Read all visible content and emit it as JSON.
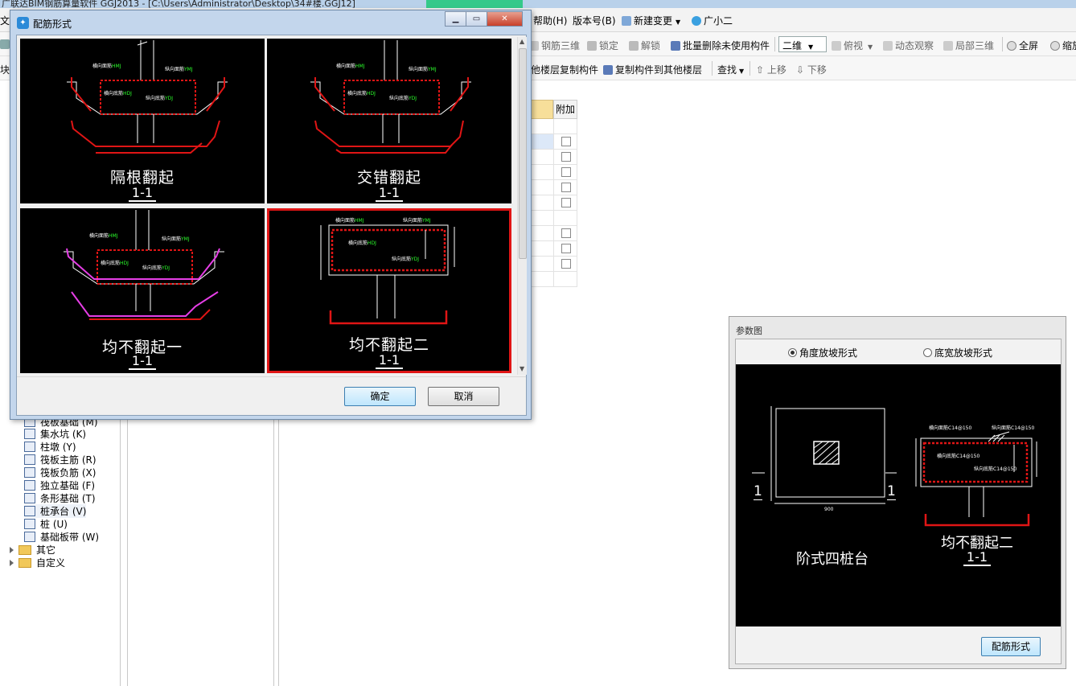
{
  "app": {
    "title": "广联达BIM钢筋算量软件 GGJ2013 - [C:\\Users\\Administrator\\Desktop\\34#楼.GGJ12]"
  },
  "menubar": {
    "help": "帮助(H)",
    "version": "版本号(B)",
    "new_change": "新建变更",
    "assistant": "广小二"
  },
  "toolbar1": {
    "rebar_3d": "钢筋三维",
    "lock": "锁定",
    "unlock": "解锁",
    "batch_delete": "批量删除未使用构件",
    "view_mode": "二维",
    "top_view": "俯视",
    "dynamic_view": "动态观察",
    "local_3d": "局部三维",
    "fullscreen": "全屏",
    "zoom": "缩放"
  },
  "toolbar2": {
    "copy_from_floor": "他楼层复制构件",
    "copy_to_floor": "复制构件到其他楼层",
    "find": "查找",
    "move_up": "上移",
    "move_down": "下移"
  },
  "left_tree": {
    "items": [
      {
        "label": "筏板基础 (M)"
      },
      {
        "label": "集水坑 (K)"
      },
      {
        "label": "柱墩 (Y)"
      },
      {
        "label": "筏板主筋 (R)"
      },
      {
        "label": "筏板负筋 (X)"
      },
      {
        "label": "独立基础 (F)"
      },
      {
        "label": "条形基础 (T)"
      },
      {
        "label": "桩承台 (V)"
      },
      {
        "label": "桩 (U)"
      },
      {
        "label": "基础板带 (W)"
      }
    ],
    "folders": [
      {
        "label": "其它"
      },
      {
        "label": "自定义"
      }
    ]
  },
  "prop_table": {
    "header": "附加"
  },
  "dialog": {
    "title": "配筋形式",
    "ok": "确定",
    "cancel": "取消",
    "options": [
      {
        "label": "隔根翻起",
        "sub": "1-1",
        "selected": false
      },
      {
        "label": "交错翻起",
        "sub": "1-1",
        "selected": false
      },
      {
        "label": "均不翻起一",
        "sub": "1-1",
        "selected": false
      },
      {
        "label": "均不翻起二",
        "sub": "1-1",
        "selected": true
      }
    ],
    "drawing_text": {
      "trans_top": "横向面筋",
      "long_top": "纵向面筋",
      "trans_bot": "横向底筋",
      "long_bot": "纵向底筋",
      "code_top": "HMJ",
      "code_ltop": "YMJ",
      "code_bot": "HDJ",
      "code_lbot": "YDJ"
    }
  },
  "param_panel": {
    "title": "参数图",
    "radio_angle": "角度放坡形式",
    "radio_width": "底宽放坡形式",
    "plan_label": "阶式四桩台",
    "section_label": "均不翻起二",
    "section_sub": "1-1",
    "mark_left": "1",
    "mark_right": "1",
    "dim_w": "900",
    "button": "配筋形式",
    "sec_text": {
      "trans_top": "横向面筋C14@150",
      "long_top": "纵向面筋C14@150",
      "trans_bot": "横向底筋C14@150",
      "long_bot": "纵向底筋C14@150"
    }
  }
}
